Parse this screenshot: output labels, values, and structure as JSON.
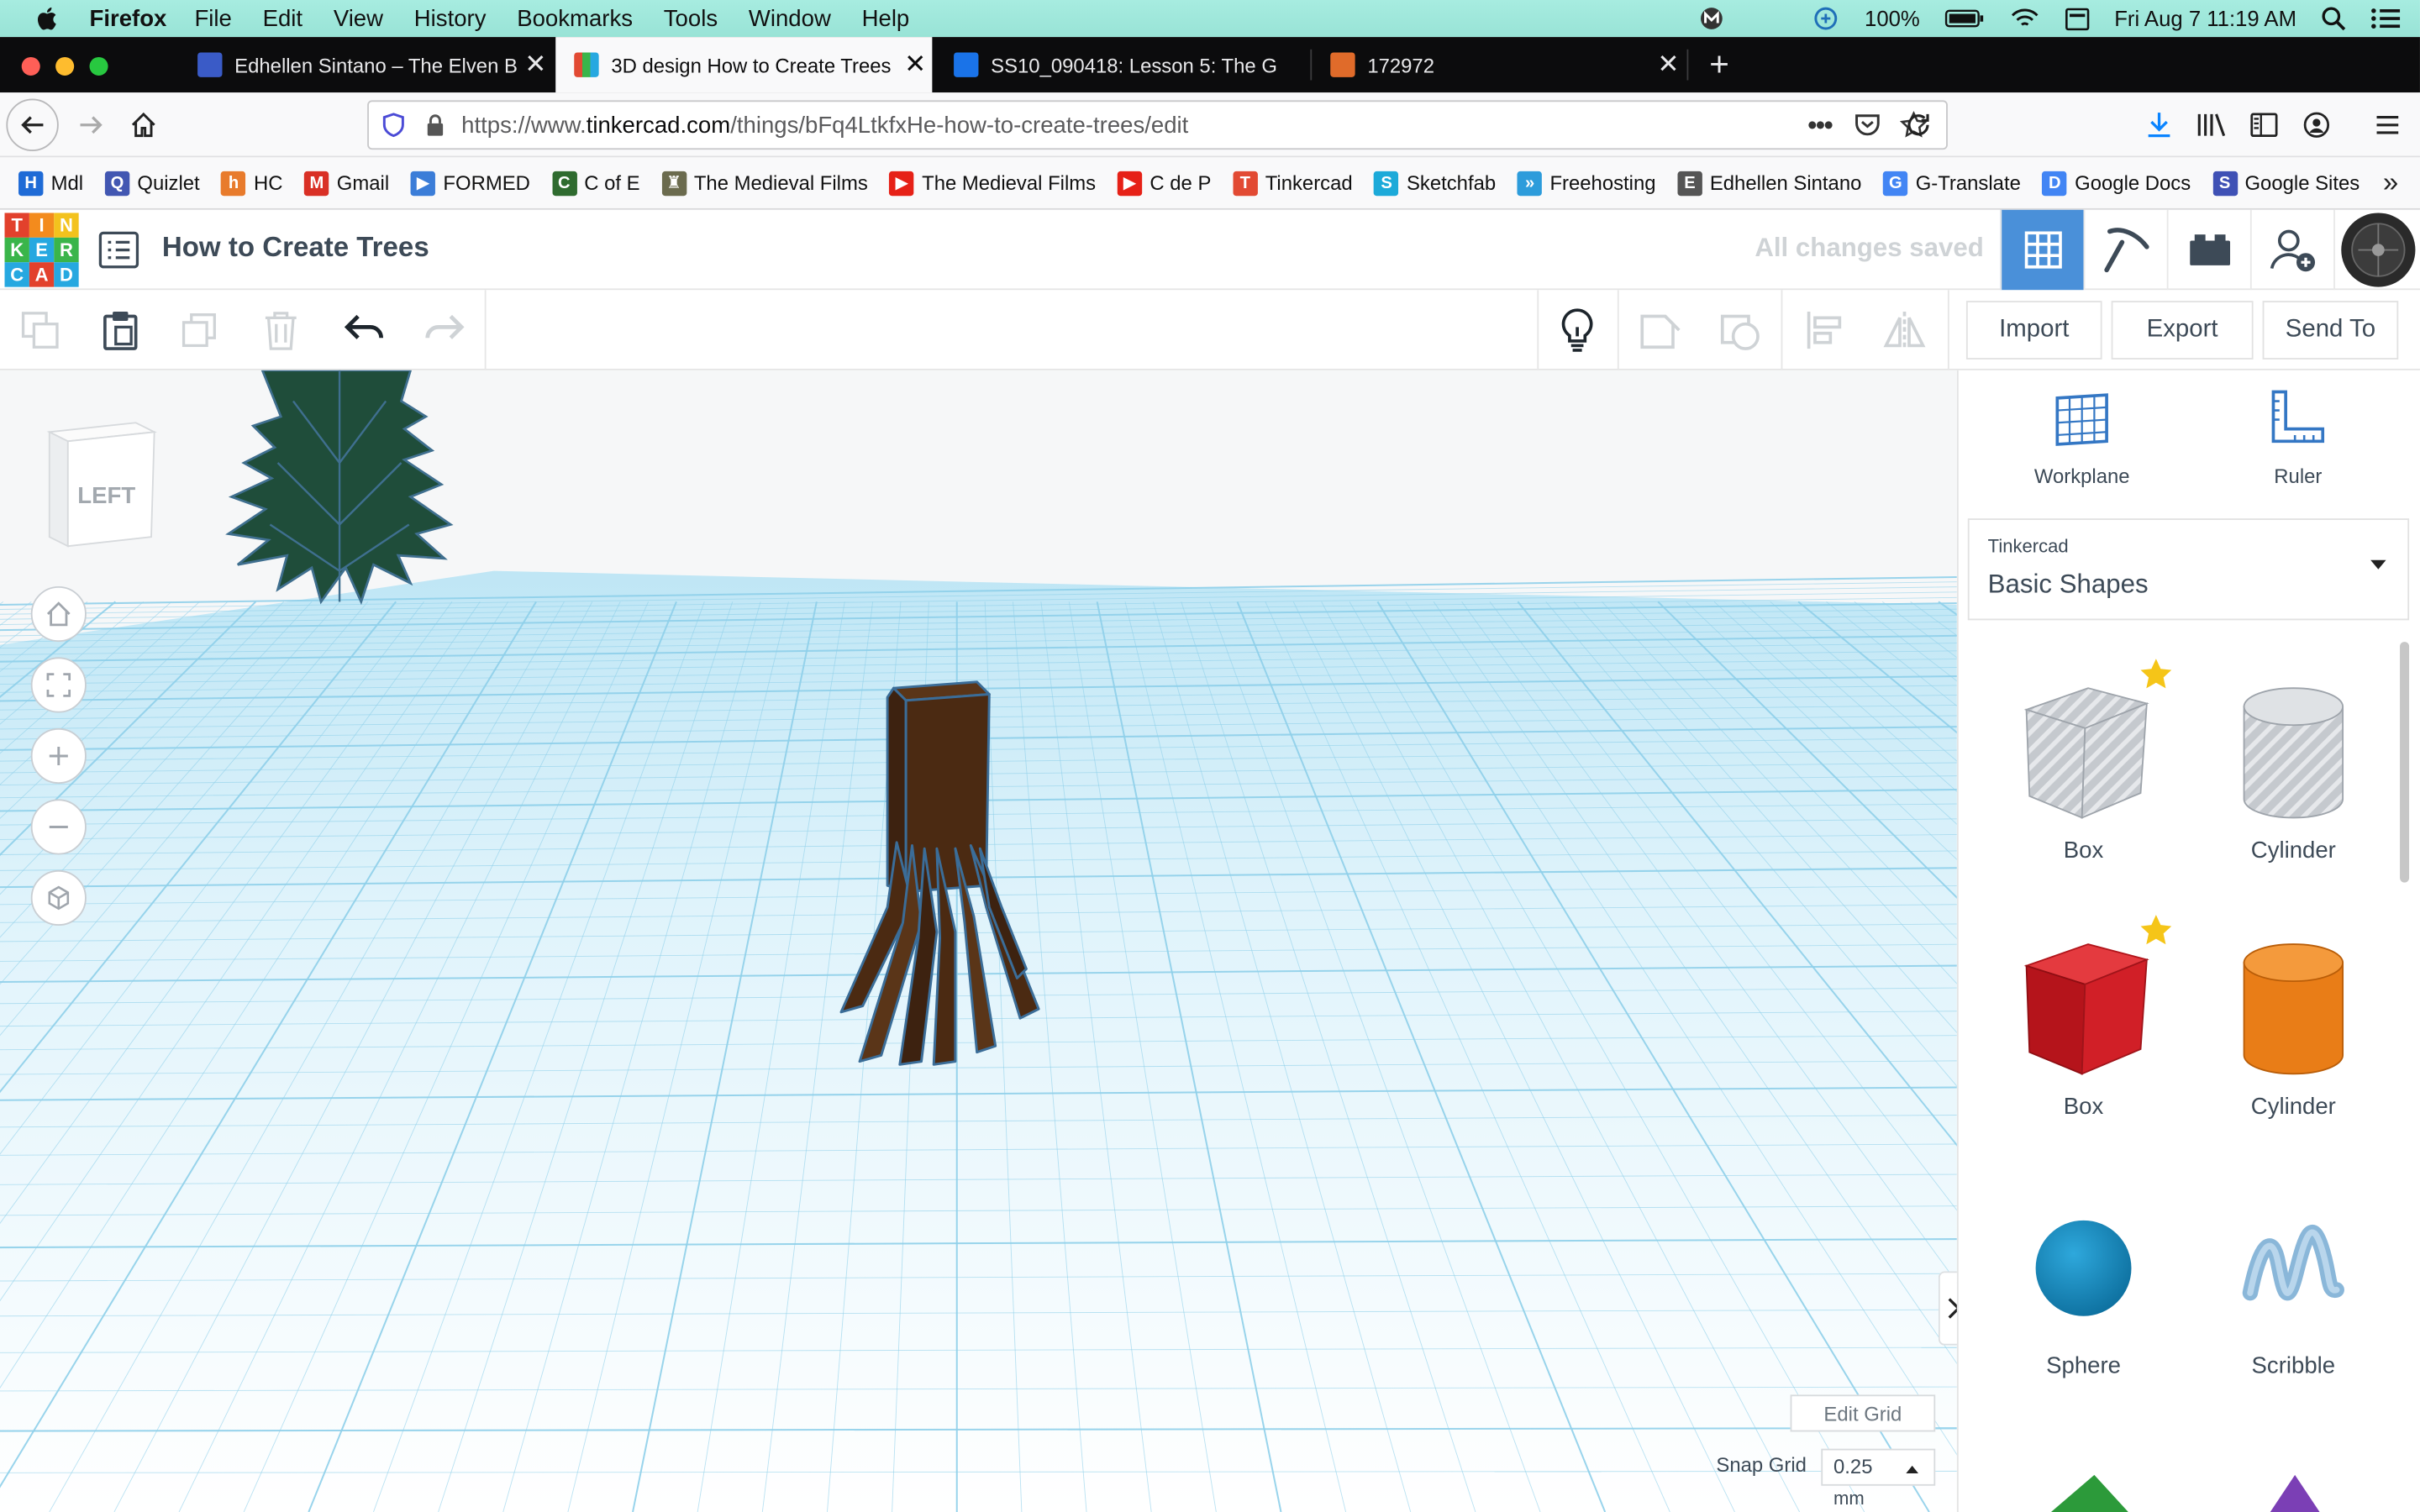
{
  "menubar": {
    "app_name": "Firefox",
    "items": [
      "File",
      "Edit",
      "View",
      "History",
      "Bookmarks",
      "Tools",
      "Window",
      "Help"
    ],
    "battery": "100%",
    "clock": "Fri Aug 7  11:19 AM"
  },
  "tabs": [
    {
      "title": "Edhellen Sintano – The Elven B",
      "favicon_color": "#3a5bc7"
    },
    {
      "title": "3D design How to Create Trees",
      "favicon_color": "#e24a33",
      "active": true
    },
    {
      "title": "SS10_090418: Lesson 5: The G",
      "favicon_color": "#1a73e8"
    },
    {
      "title": "172972",
      "favicon_color": "#e06b2a"
    }
  ],
  "navbar": {
    "url_prefix": "https://www.",
    "url_domain": "tinkercad.com",
    "url_path": "/things/bFq4LtkfxHe-how-to-create-trees/edit"
  },
  "bookmarks": [
    {
      "label": "Mdl",
      "icon": "H",
      "color": "#1f6bd6"
    },
    {
      "label": "Quizlet",
      "icon": "Q",
      "color": "#4257b2"
    },
    {
      "label": "HC",
      "icon": "h",
      "color": "#e87b2c"
    },
    {
      "label": "Gmail",
      "icon": "M",
      "color": "#d93025"
    },
    {
      "label": "FORMED",
      "icon": "▶",
      "color": "#3b7dd8"
    },
    {
      "label": "C of E",
      "icon": "C",
      "color": "#2f6b2f"
    },
    {
      "label": "The Medieval Films",
      "icon": "♜",
      "color": "#6b6b4e"
    },
    {
      "label": "The Medieval Films",
      "icon": "▶",
      "color": "#e62117"
    },
    {
      "label": "C de P",
      "icon": "▶",
      "color": "#e62117"
    },
    {
      "label": "Tinkercad",
      "icon": "T",
      "color": "#e24a33"
    },
    {
      "label": "Sketchfab",
      "icon": "S",
      "color": "#1caad9"
    },
    {
      "label": "Freehosting",
      "icon": "»",
      "color": "#2d9cdb"
    },
    {
      "label": "Edhellen Sintano",
      "icon": "E",
      "color": "#555555"
    },
    {
      "label": "G-Translate",
      "icon": "G",
      "color": "#4285f4"
    },
    {
      "label": "Google Docs",
      "icon": "D",
      "color": "#4285f4"
    },
    {
      "label": "Google Sites",
      "icon": "S",
      "color": "#3f51b5"
    }
  ],
  "tinkercad": {
    "logo_letters": [
      "T",
      "I",
      "N",
      "K",
      "E",
      "R",
      "C",
      "A",
      "D"
    ],
    "logo_colors": [
      "#e2412c",
      "#f38b1d",
      "#f3c21d",
      "#3ab54a",
      "#26a8e0",
      "#3ab54a",
      "#26a8e0",
      "#e2412c",
      "#26a8e0"
    ],
    "design_title": "How to Create Trees",
    "save_status": "All changes saved"
  },
  "toolbar": {
    "import_label": "Import",
    "export_label": "Export",
    "send_to_label": "Send To"
  },
  "viewport": {
    "view_cube_face": "LEFT",
    "edit_grid_label": "Edit Grid",
    "snap_grid_label": "Snap Grid",
    "snap_grid_value": "0.25",
    "snap_grid_unit": "mm"
  },
  "panel": {
    "workplane_label": "Workplane",
    "ruler_label": "Ruler",
    "library_source": "Tinkercad",
    "library_name": "Basic Shapes",
    "shapes": [
      {
        "label": "Box",
        "color": "#b8bcc2",
        "favorite": true
      },
      {
        "label": "Cylinder",
        "color": "#b8bcc2",
        "favorite": false
      },
      {
        "label": "Box",
        "color": "#d11f27",
        "favorite": true
      },
      {
        "label": "Cylinder",
        "color": "#e97d17",
        "favorite": false
      },
      {
        "label": "Sphere",
        "color": "#1a8fc4",
        "favorite": false
      },
      {
        "label": "Scribble",
        "color": "#8ab7d9",
        "favorite": false
      }
    ]
  },
  "colors": {
    "grid_line": "#8fd0ea",
    "grid_bg": "#ffffff",
    "trunk": "#4b2a12",
    "tree_foliage": "#1f4d3a",
    "accent_blue": "#4a90d9"
  }
}
